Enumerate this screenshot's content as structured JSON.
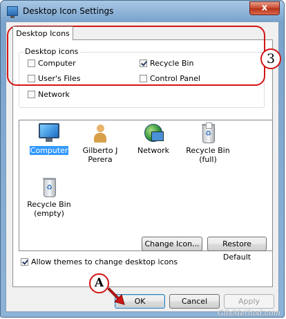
{
  "window": {
    "title": "Desktop Icon Settings",
    "close_label": "x"
  },
  "tabs": [
    {
      "label": "Desktop Icons"
    }
  ],
  "desktop_icons_group": {
    "legend": "Desktop icons",
    "items": [
      {
        "label": "Computer",
        "checked": false
      },
      {
        "label": "User's Files",
        "checked": false
      },
      {
        "label": "Network",
        "checked": false
      },
      {
        "label": "Recycle Bin",
        "checked": true
      },
      {
        "label": "Control Panel",
        "checked": false
      }
    ]
  },
  "icon_list": [
    {
      "label": "Computer",
      "icon": "computer-icon",
      "selected": true
    },
    {
      "label": "Gilberto J Perera",
      "icon": "user-folder-icon",
      "selected": false
    },
    {
      "label": "Network",
      "icon": "network-icon",
      "selected": false
    },
    {
      "label": "Recycle Bin (full)",
      "icon": "recycle-bin-full-icon",
      "selected": false
    },
    {
      "label": "Recycle Bin (empty)",
      "icon": "recycle-bin-empty-icon",
      "selected": false
    }
  ],
  "buttons": {
    "change_icon": "Change Icon...",
    "restore_default": "Restore Default",
    "ok": "OK",
    "cancel": "Cancel",
    "apply": "Apply"
  },
  "allow_themes": {
    "label": "Allow themes to change desktop icons",
    "checked": true
  },
  "annotations": {
    "step_number": "3",
    "step_letter": "A"
  },
  "watermark": "GilsMethod.com",
  "colors": {
    "annotation_red": "#d21414",
    "selection_blue": "#3399ff"
  }
}
